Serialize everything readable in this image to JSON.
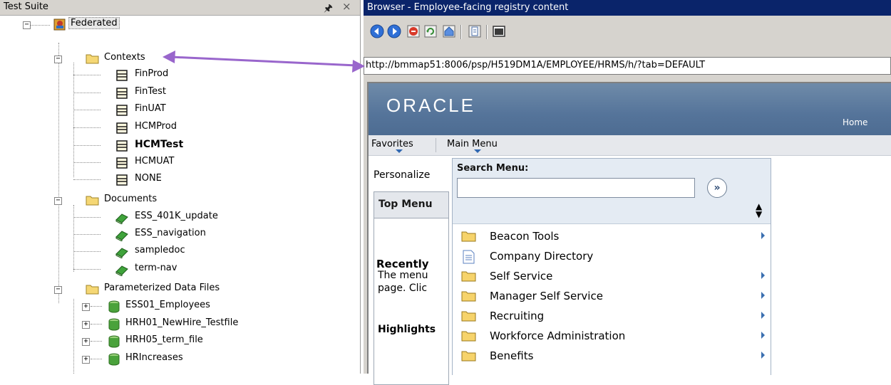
{
  "test_suite": {
    "title": "Test Suite",
    "root": "Federated",
    "contexts_label": "Contexts",
    "contexts": [
      "FinProd",
      "FinTest",
      "FinUAT",
      "HCMProd",
      "HCMTest",
      "HCMUAT",
      "NONE"
    ],
    "documents_label": "Documents",
    "documents": [
      "ESS_401K_update",
      "ESS_navigation",
      "sampledoc",
      "term-nav"
    ],
    "data_files_label": "Parameterized Data Files",
    "data_files": [
      "ESS01_Employees",
      "HRH01_NewHire_Testfile",
      "HRH05_term_file",
      "HRIncreases"
    ]
  },
  "browser": {
    "title": "Browser - Employee-facing registry content",
    "url": "http://bmmap51:8006/psp/H519DM1A/EMPLOYEE/HRMS/h/?tab=DEFAULT"
  },
  "page": {
    "logo": "ORACLE",
    "home_link": "Home",
    "menu_favorites": "Favorites",
    "menu_main": "Main Menu",
    "personalize": "Personalize",
    "top_menu": "Top Menu",
    "body_line1": "The menu",
    "body_line2": "page. Clic",
    "highlights": "Highlights",
    "recently": "Recently"
  },
  "search_menu": {
    "label": "Search Menu:",
    "value": "",
    "go_glyph": "»",
    "items": [
      {
        "label": "Beacon Tools",
        "icon": "folder-icon",
        "has_submenu": true
      },
      {
        "label": "Company Directory",
        "icon": "document-icon",
        "has_submenu": false
      },
      {
        "label": "Self Service",
        "icon": "folder-icon",
        "has_submenu": true
      },
      {
        "label": "Manager Self Service",
        "icon": "folder-icon",
        "has_submenu": true
      },
      {
        "label": "Recruiting",
        "icon": "folder-icon",
        "has_submenu": true
      },
      {
        "label": "Workforce Administration",
        "icon": "folder-icon",
        "has_submenu": true
      },
      {
        "label": "Benefits",
        "icon": "folder-icon",
        "has_submenu": true
      }
    ]
  },
  "colors": {
    "title_bar": "#0a246a",
    "annotation_arrow": "#9966cc",
    "banner": "#5a789c"
  }
}
